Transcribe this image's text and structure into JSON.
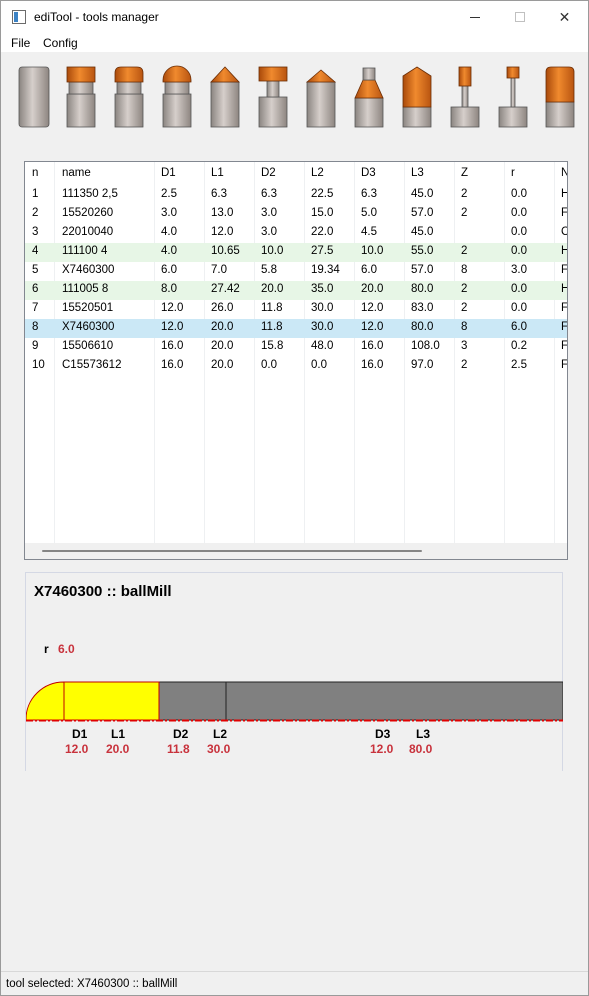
{
  "window": {
    "title": "ediTool - tools manager",
    "min_symbol": "",
    "close_symbol": "✕"
  },
  "menu": {
    "file": "File",
    "config": "Config"
  },
  "toolbar": {
    "tools": [
      {
        "name": "flatMill",
        "icon": "flat-mill-icon"
      },
      {
        "name": "steppedTool",
        "icon": "stepped-tool-icon"
      },
      {
        "name": "bullMill",
        "icon": "bull-mill-icon"
      },
      {
        "name": "ballMill",
        "icon": "ball-mill-icon"
      },
      {
        "name": "chamferMill",
        "icon": "chamfer-mill-icon"
      },
      {
        "name": "tSlotMill",
        "icon": "t-slot-mill-icon"
      },
      {
        "name": "drill",
        "icon": "drill-icon"
      },
      {
        "name": "centerDrill",
        "icon": "center-drill-icon"
      },
      {
        "name": "counterSink",
        "icon": "countersink-icon"
      },
      {
        "name": "engraving",
        "icon": "engraving-icon"
      },
      {
        "name": "smallEngraving",
        "icon": "small-engraving-icon"
      },
      {
        "name": "roughMill",
        "icon": "rough-mill-icon"
      }
    ]
  },
  "table": {
    "columns": [
      "n",
      "name",
      "D1",
      "L1",
      "D2",
      "L2",
      "D3",
      "L3",
      "Z",
      "r",
      "N"
    ],
    "rows": [
      [
        "1",
        "111350 2,5",
        "2.5",
        "6.3",
        "6.3",
        "22.5",
        "6.3",
        "45.0",
        "2",
        "0.0",
        "H"
      ],
      [
        "2",
        "15520260",
        "3.0",
        "13.0",
        "3.0",
        "15.0",
        "5.0",
        "57.0",
        "2",
        "0.0",
        "F"
      ],
      [
        "3",
        "22010040",
        "4.0",
        "12.0",
        "3.0",
        "22.0",
        "4.5",
        "45.0",
        "",
        "0.0",
        "C"
      ],
      [
        "4",
        "111100 4",
        "4.0",
        "10.65",
        "10.0",
        "27.5",
        "10.0",
        "55.0",
        "2",
        "0.0",
        "H"
      ],
      [
        "5",
        "X7460300",
        "6.0",
        "7.0",
        "5.8",
        "19.34",
        "6.0",
        "57.0",
        "8",
        "3.0",
        "F"
      ],
      [
        "6",
        "111005 8",
        "8.0",
        "27.42",
        "20.0",
        "35.0",
        "20.0",
        "80.0",
        "2",
        "0.0",
        "H"
      ],
      [
        "7",
        "15520501",
        "12.0",
        "26.0",
        "11.8",
        "30.0",
        "12.0",
        "83.0",
        "2",
        "0.0",
        "F"
      ],
      [
        "8",
        "X7460300",
        "12.0",
        "20.0",
        "11.8",
        "30.0",
        "12.0",
        "80.0",
        "8",
        "6.0",
        "F"
      ],
      [
        "9",
        "15506610",
        "16.0",
        "20.0",
        "15.8",
        "48.0",
        "16.0",
        "108.0",
        "3",
        "0.2",
        "F"
      ],
      [
        "10",
        "C15573612",
        "16.0",
        "20.0",
        "0.0",
        "0.0",
        "16.0",
        "97.0",
        "2",
        "2.5",
        "F"
      ]
    ],
    "row_states": [
      "",
      "",
      "",
      "alt",
      "",
      "alt",
      "",
      "sel",
      "",
      ""
    ]
  },
  "detail": {
    "title": "X7460300 :: ballMill",
    "r_label": "r",
    "r_value": "6.0",
    "D1_label": "D1",
    "D1_value": "12.0",
    "L1_label": "L1",
    "L1_value": "20.0",
    "D2_label": "D2",
    "D2_value": "11.8",
    "L2_label": "L2",
    "L2_value": "30.0",
    "D3_label": "D3",
    "D3_value": "12.0",
    "L3_label": "L3",
    "L3_value": "80.0"
  },
  "status": {
    "text": "tool selected: X7460300 :: ballMill"
  },
  "colors": {
    "selected_row": "#cbe8f6",
    "alt_row": "#e7f6e6",
    "value_red": "#c8323c",
    "cutter_yellow": "#ffff00",
    "shank_gray": "#808080",
    "tool_copper": "#d2691e"
  }
}
